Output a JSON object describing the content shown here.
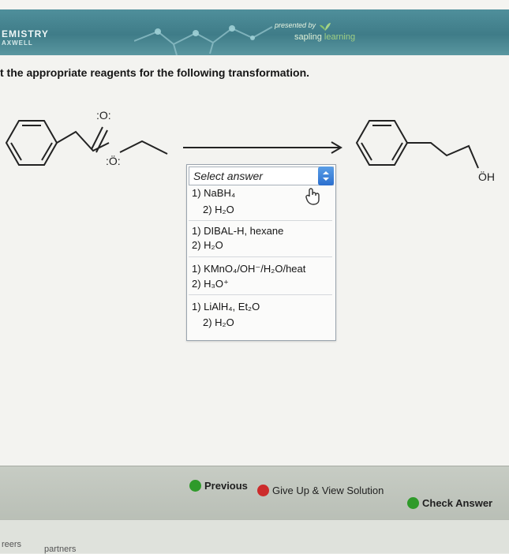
{
  "header": {
    "title": "EMISTRY",
    "subtitle": "AXWELL",
    "presented_by": "presented by",
    "brand_sapling": "sapling",
    "brand_learning": "learning"
  },
  "question": {
    "text": "t the appropriate reagents for the following transformation."
  },
  "diagram": {
    "reactant_carbonyl_o": ":O:",
    "reactant_ester_o": ":Ö:",
    "product_hydroxyl": "ÖH"
  },
  "select": {
    "placeholder": "Select answer",
    "options": [
      {
        "line1": "1) NaBH₄",
        "line2": "2) H₂O"
      },
      {
        "line1": "1) DIBAL-H, hexane",
        "line2": "2) H₂O"
      },
      {
        "line1": "1) KMnO₄/OH⁻/H₂O/heat",
        "line2": "2) H₃O⁺"
      },
      {
        "line1": "1) LiAlH₄, Et₂O",
        "line2": "2) H₂O"
      }
    ]
  },
  "buttons": {
    "previous": "Previous",
    "give_up": "Give Up & View Solution",
    "check": "Check Answer"
  },
  "footer": {
    "link1": "reers",
    "link2": "partners"
  },
  "colors": {
    "banner": "#4f8f9b",
    "accent_blue": "#2b6fcf",
    "check_green": "#2f9a2a",
    "giveup_red": "#cc2b2b"
  }
}
